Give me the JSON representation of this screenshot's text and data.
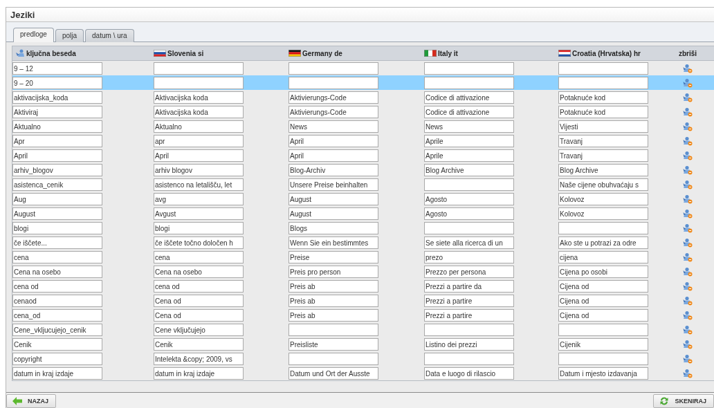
{
  "window": {
    "title": "Jeziki"
  },
  "tabs": [
    {
      "label": "predloge",
      "selected": true
    },
    {
      "label": "polja",
      "selected": false
    },
    {
      "label": "datum \\ ura",
      "selected": false
    }
  ],
  "table": {
    "columns": [
      "ključna beseda",
      "Slovenia si",
      "Germany de",
      "Italy it",
      "Croatia (Hrvatska) hr"
    ],
    "delete_column": "zbriši",
    "rows": [
      {
        "selected": false,
        "cells": [
          "9 – 12",
          "",
          "",
          "",
          ""
        ]
      },
      {
        "selected": true,
        "cells": [
          "9 – 20",
          "",
          "",
          "",
          ""
        ]
      },
      {
        "selected": false,
        "cells": [
          "aktivacijska_koda",
          "Aktivacijska koda",
          "Aktivierungs-Code",
          "Codice di attivazione",
          "Potaknuće kod"
        ]
      },
      {
        "selected": false,
        "cells": [
          "Aktiviraj",
          "Aktivacijska koda",
          "Aktivierungs-Code",
          "Codice di attivazione",
          "Potaknuće kod"
        ]
      },
      {
        "selected": false,
        "cells": [
          "Aktualno",
          "Aktualno",
          "News",
          "News",
          "Vijesti"
        ]
      },
      {
        "selected": false,
        "cells": [
          "Apr",
          "apr",
          "April",
          "Aprile",
          "Travanj"
        ]
      },
      {
        "selected": false,
        "cells": [
          "April",
          "April",
          "April",
          "Aprile",
          "Travanj"
        ]
      },
      {
        "selected": false,
        "cells": [
          "arhiv_blogov",
          "arhiv blogov",
          "Blog-Archiv",
          "Blog Archive",
          "Blog Archive"
        ]
      },
      {
        "selected": false,
        "cells": [
          "asistenca_cenik",
          "asistenco na letališču, let",
          "Unsere Preise beinhalten",
          "",
          "Naše cijene obuhvaćaju s"
        ]
      },
      {
        "selected": false,
        "cells": [
          "Aug",
          "avg",
          "August",
          "Agosto",
          "Kolovoz"
        ]
      },
      {
        "selected": false,
        "cells": [
          "August",
          "Avgust",
          "August",
          "Agosto",
          "Kolovoz"
        ]
      },
      {
        "selected": false,
        "cells": [
          "blogi",
          "blogi",
          "Blogs",
          "",
          ""
        ]
      },
      {
        "selected": false,
        "cells": [
          "če iščete...",
          "če iščete točno določen h",
          "Wenn Sie ein bestimmtes",
          "Se siete alla ricerca di un",
          "Ako ste u potrazi za odre"
        ]
      },
      {
        "selected": false,
        "cells": [
          "cena",
          "cena",
          "Preise",
          "prezo",
          "cijena"
        ]
      },
      {
        "selected": false,
        "cells": [
          "Cena na osebo",
          "Cena na osebo",
          "Preis pro person",
          "Prezzo per persona",
          "Cijena po osobi"
        ]
      },
      {
        "selected": false,
        "cells": [
          "cena od",
          "cena od",
          "Preis ab",
          "Prezzi a partire da",
          "Cijena od"
        ]
      },
      {
        "selected": false,
        "cells": [
          "cenaod",
          "Cena od",
          "Preis ab",
          "Prezzi a partire",
          "Cijena od"
        ]
      },
      {
        "selected": false,
        "cells": [
          "cena_od",
          "Cena od",
          "Preis ab",
          "Prezzi a partire",
          "Cijena od"
        ]
      },
      {
        "selected": false,
        "cells": [
          "Cene_vkljucujejo_cenik",
          "Cene vključujejo",
          "",
          "",
          ""
        ]
      },
      {
        "selected": false,
        "cells": [
          "Cenik",
          "Cenik",
          "Preisliste",
          "Listino dei prezzi",
          "Cijenik"
        ]
      },
      {
        "selected": false,
        "cells": [
          "copyright",
          "Intelekta &copy; 2009, vs",
          "",
          "",
          ""
        ]
      },
      {
        "selected": false,
        "cells": [
          "datum in kraj izdaje",
          "datum in kraj izdaje",
          "Datum und Ort der Ausste",
          "Data e luogo di rilascio",
          "Datum i mjesto izdavanja"
        ]
      }
    ]
  },
  "footer": {
    "back_button": "NAZAJ",
    "scan_button": "SKENIRAJ"
  }
}
